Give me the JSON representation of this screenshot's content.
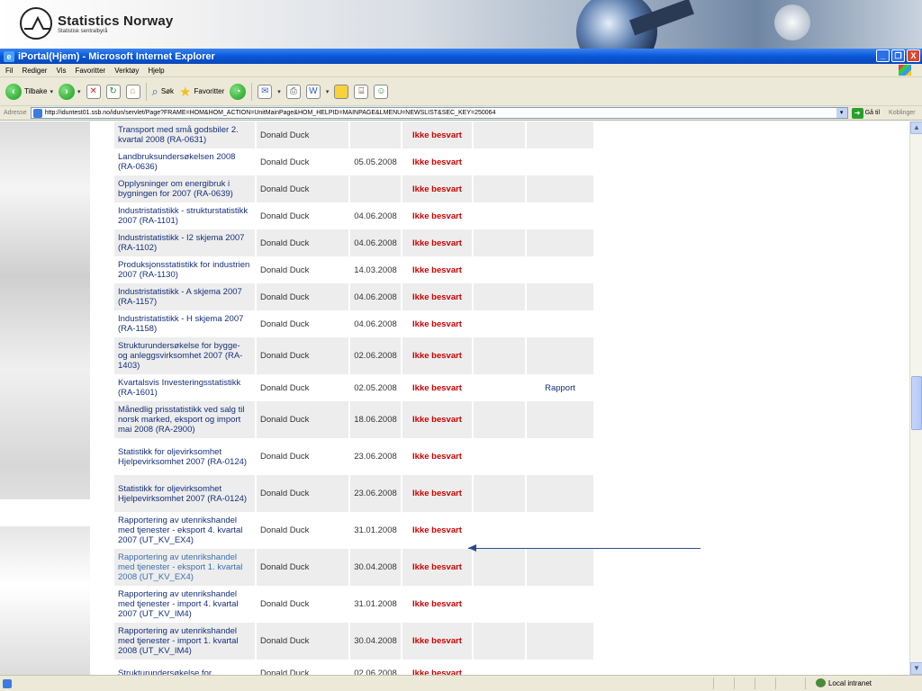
{
  "banner": {
    "logo_title": "Statistics Norway",
    "logo_subtitle": "Statistisk sentralbyrå"
  },
  "window": {
    "title": "iPortal(Hjem) - Microsoft Internet Explorer",
    "buttons": [
      "_",
      "❐",
      "X"
    ]
  },
  "menu": [
    "Fil",
    "Rediger",
    "Vis",
    "Favoritter",
    "Verktøy",
    "Hjelp"
  ],
  "toolbar": {
    "back_label": "Tilbake",
    "search_label": "Søk",
    "favorites_label": "Favoritter"
  },
  "address": {
    "label": "Adresse",
    "url": "http://iduntest01.ssb.no/idun/servlet/Page?FRAME=HOM&HOM_ACTION=UnitMainPage&HOM_HELPID=MAINPAGE&LMENU=NEWSLIST&SEC_KEY=250064",
    "go_label": "Gå til",
    "links_label": "Koblinger"
  },
  "rows": [
    {
      "name": "Transport med små godsbiler 2. kvartal 2008 (RA-0631)",
      "resp": "Donald Duck",
      "date": "",
      "status": "Ikke besvart",
      "extra": "",
      "h": 30
    },
    {
      "name": "Landbruksundersøkelsen 2008 (RA-0636)",
      "resp": "Donald Duck",
      "date": "05.05.2008",
      "status": "Ikke besvart",
      "extra": "",
      "h": 30
    },
    {
      "name": "Opplysninger om energibruk i bygningen for 2007 (RA-0639)",
      "resp": "Donald Duck",
      "date": "",
      "status": "Ikke besvart",
      "extra": "",
      "h": 30
    },
    {
      "name": "Industristatistikk - strukturstatistikk 2007 (RA-1101)",
      "resp": "Donald Duck",
      "date": "04.06.2008",
      "status": "Ikke besvart",
      "extra": "",
      "h": 30
    },
    {
      "name": "Industristatistikk - I2 skjema 2007 (RA-1102)",
      "resp": "Donald Duck",
      "date": "04.06.2008",
      "status": "Ikke besvart",
      "extra": "",
      "h": 30
    },
    {
      "name": "Produksjonsstatistikk for industrien 2007 (RA-1130)",
      "resp": "Donald Duck",
      "date": "14.03.2008",
      "status": "Ikke besvart",
      "extra": "",
      "h": 30
    },
    {
      "name": "Industristatistikk - A skjema 2007 (RA-1157)",
      "resp": "Donald Duck",
      "date": "04.06.2008",
      "status": "Ikke besvart",
      "extra": "",
      "h": 30
    },
    {
      "name": "Industristatistikk - H skjema 2007 (RA-1158)",
      "resp": "Donald Duck",
      "date": "04.06.2008",
      "status": "Ikke besvart",
      "extra": "",
      "h": 30
    },
    {
      "name": "Strukturundersøkelse for bygge- og anleggsvirksomhet 2007 (RA-1403)",
      "resp": "Donald Duck",
      "date": "02.06.2008",
      "status": "Ikke besvart",
      "extra": "",
      "h": 41
    },
    {
      "name": "Kvartalsvis Investeringsstatistikk (RA-1601)",
      "resp": "Donald Duck",
      "date": "02.05.2008",
      "status": "Ikke besvart",
      "extra": "Rapport",
      "h": 30
    },
    {
      "name": "Månedlig prisstatistikk ved salg til norsk marked, eksport og import mai 2008 (RA-2900)",
      "resp": "Donald Duck",
      "date": "18.06.2008",
      "status": "Ikke besvart",
      "extra": "",
      "h": 41
    },
    {
      "name": "Statistikk for oljevirksomhet Hjelpevirksomhet 2007 (RA-0124)",
      "resp": "Donald Duck",
      "date": "23.06.2008",
      "status": "Ikke besvart",
      "extra": "",
      "h": 41
    },
    {
      "name": "Statistikk for oljevirksomhet Hjelpevirksomhet 2007 (RA-0124)",
      "resp": "Donald Duck",
      "date": "23.06.2008",
      "status": "Ikke besvart",
      "extra": "",
      "h": 41
    },
    {
      "name": "Rapportering av utenrikshandel med tjenester - eksport 4. kvartal 2007 (UT_KV_EX4)",
      "resp": "Donald Duck",
      "date": "31.01.2008",
      "status": "Ikke besvart",
      "extra": "",
      "h": 41
    },
    {
      "name": "Rapportering av utenrikshandel med tjenester - eksport 1. kvartal 2008 (UT_KV_EX4)",
      "resp": "Donald Duck",
      "date": "30.04.2008",
      "status": "Ikke besvart",
      "extra": "",
      "h": 41,
      "visited": true
    },
    {
      "name": "Rapportering av utenrikshandel med tjenester - import 4. kvartal 2007 (UT_KV_IM4)",
      "resp": "Donald Duck",
      "date": "31.01.2008",
      "status": "Ikke besvart",
      "extra": "",
      "h": 41
    },
    {
      "name": "Rapportering av utenrikshandel med tjenester - import 1. kvartal 2008 (UT_KV_IM4)",
      "resp": "Donald Duck",
      "date": "30.04.2008",
      "status": "Ikke besvart",
      "extra": "",
      "h": 41
    },
    {
      "name": "Strukturundersøkelse for",
      "resp": "Donald Duck",
      "date": "02.06.2008",
      "status": "Ikke besvart",
      "extra": "",
      "h": 30
    }
  ],
  "status": {
    "zone": "Local intranet"
  }
}
